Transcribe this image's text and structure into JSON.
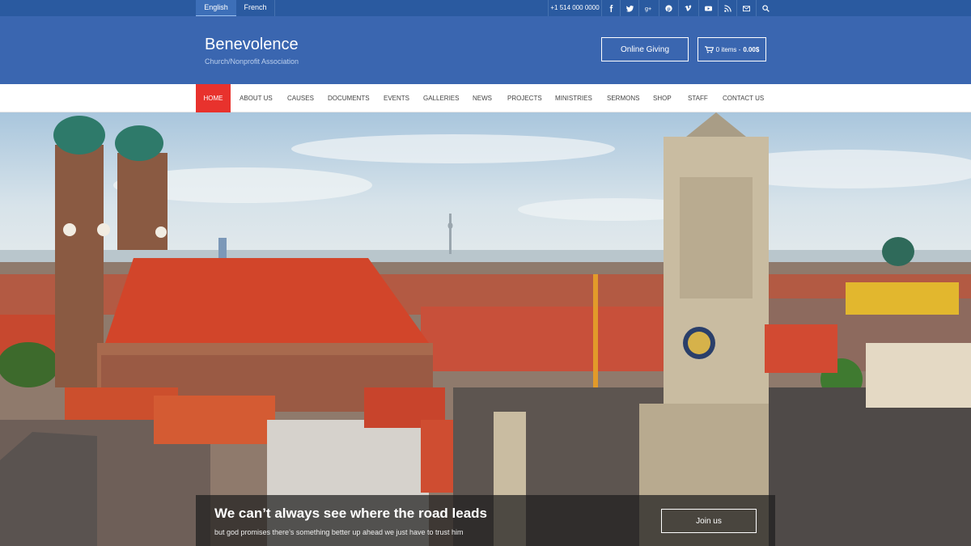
{
  "topbar": {
    "languages": [
      {
        "label": "English"
      },
      {
        "label": "French"
      }
    ],
    "phone": "+1 514 000 0000",
    "social_icons": [
      "facebook-icon",
      "twitter-icon",
      "google-plus-icon",
      "pinterest-icon",
      "vimeo-icon",
      "youtube-icon",
      "rss-icon",
      "mail-icon",
      "search-icon"
    ]
  },
  "header": {
    "brand": "Benevolence",
    "tagline": "Church/Nonprofit Association",
    "giving_label": "Online Giving",
    "cart_items": "0 items -",
    "cart_total": "0.00$"
  },
  "nav": {
    "items": [
      {
        "label": "HOME"
      },
      {
        "label": "ABOUT US"
      },
      {
        "label": "CAUSES"
      },
      {
        "label": "DOCUMENTS"
      },
      {
        "label": "EVENTS"
      },
      {
        "label": "GALLERIES"
      },
      {
        "label": "NEWS"
      },
      {
        "label": "PROJECTS"
      },
      {
        "label": "MINISTRIES"
      },
      {
        "label": "SERMONS"
      },
      {
        "label": "SHOP"
      },
      {
        "label": "STAFF"
      },
      {
        "label": "CONTACT US"
      }
    ]
  },
  "hero": {
    "title": "We can’t always see where the road leads",
    "subtitle": "but god promises there’s something better up ahead we just have to trust him",
    "button": "Join us"
  },
  "colors": {
    "topbar": "#2a5aa0",
    "header": "#3a66b0",
    "active_nav": "#e8322d"
  }
}
